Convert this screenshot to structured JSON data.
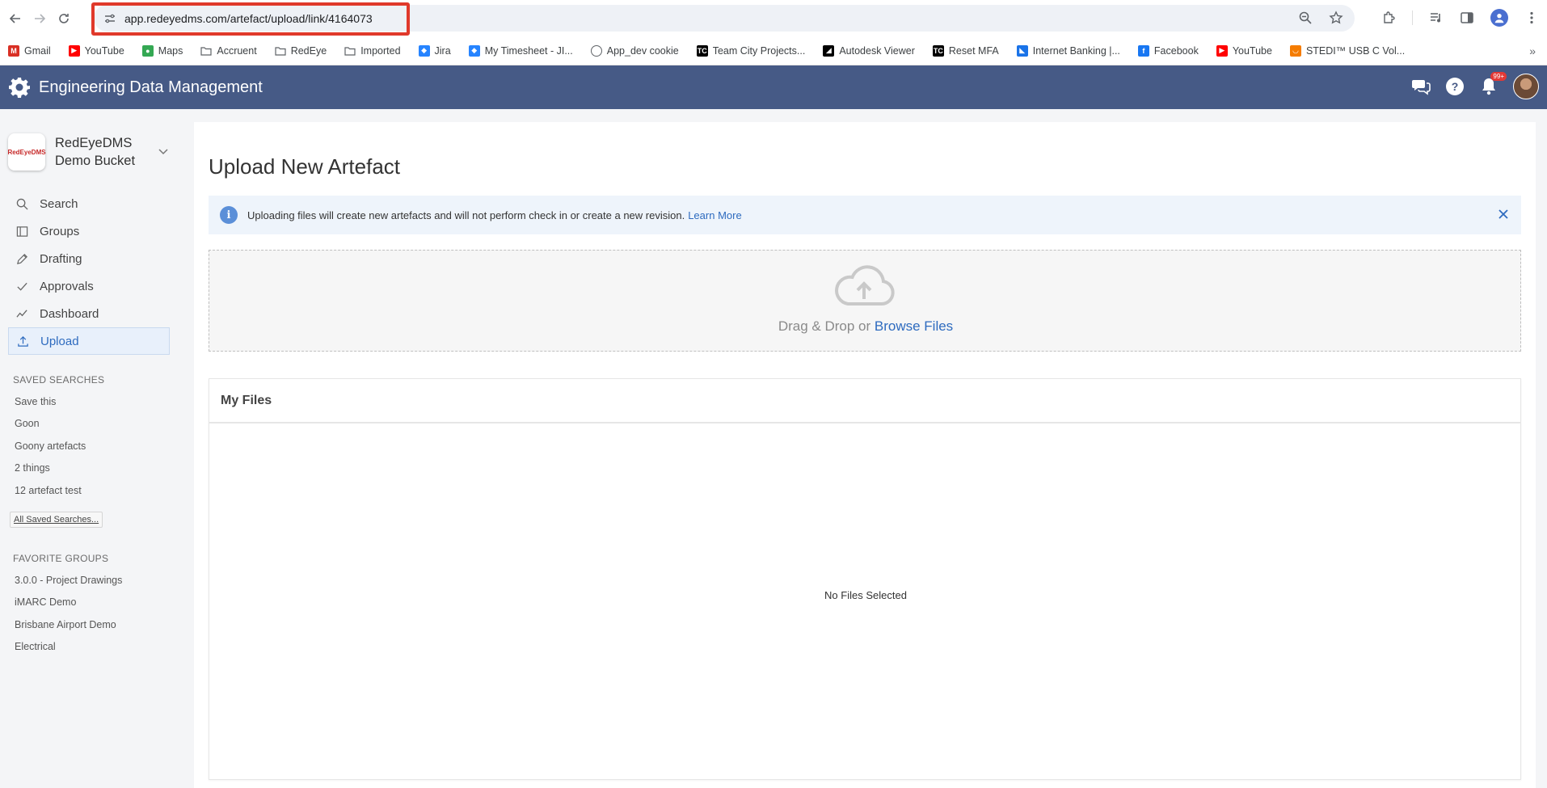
{
  "browser": {
    "url": "app.redeyedms.com/artefact/upload/link/4164073",
    "bookmarks": [
      {
        "label": "Gmail",
        "icon": "gmail-icon",
        "color": "#d93025"
      },
      {
        "label": "YouTube",
        "icon": "youtube-icon",
        "color": "#ff0000"
      },
      {
        "label": "Maps",
        "icon": "maps-icon",
        "color": "#34a853"
      },
      {
        "label": "Accruent",
        "icon": "folder-icon",
        "color": "#5f6368"
      },
      {
        "label": "RedEye",
        "icon": "folder-icon",
        "color": "#5f6368"
      },
      {
        "label": "Imported",
        "icon": "folder-icon",
        "color": "#5f6368"
      },
      {
        "label": "Jira",
        "icon": "jira-icon",
        "color": "#2684ff"
      },
      {
        "label": "My Timesheet - JI...",
        "icon": "jira-icon",
        "color": "#2684ff"
      },
      {
        "label": "App_dev cookie",
        "icon": "globe-icon",
        "color": "#5f6368"
      },
      {
        "label": "Team City Projects...",
        "icon": "teamcity-icon",
        "color": "#000000"
      },
      {
        "label": "Autodesk Viewer",
        "icon": "autodesk-icon",
        "color": "#000000"
      },
      {
        "label": "Reset MFA",
        "icon": "teamcity-icon",
        "color": "#000000"
      },
      {
        "label": "Internet Banking |...",
        "icon": "bank-icon",
        "color": "#1a73e8"
      },
      {
        "label": "Facebook",
        "icon": "facebook-icon",
        "color": "#1877f2"
      },
      {
        "label": "YouTube",
        "icon": "youtube-icon",
        "color": "#ff0000"
      },
      {
        "label": "STEDI™ USB C Vol...",
        "icon": "stedi-icon",
        "color": "#f57c00"
      }
    ]
  },
  "app": {
    "title": "Engineering Data Management",
    "notification_badge": "99+"
  },
  "workspace": {
    "logo_text": "RedEyeDMS",
    "name": "RedEyeDMS Demo Bucket"
  },
  "menu": [
    {
      "label": "Search",
      "icon": "search-icon"
    },
    {
      "label": "Groups",
      "icon": "groups-icon"
    },
    {
      "label": "Drafting",
      "icon": "pencil-icon"
    },
    {
      "label": "Approvals",
      "icon": "check-icon"
    },
    {
      "label": "Dashboard",
      "icon": "chart-line-icon"
    },
    {
      "label": "Upload",
      "icon": "upload-icon"
    }
  ],
  "saved_searches": {
    "title": "SAVED SEARCHES",
    "items": [
      "Save this",
      "Goon",
      "Goony artefacts",
      "2 things",
      "12 artefact test"
    ],
    "all_label": "All Saved Searches..."
  },
  "favorite_groups": {
    "title": "FAVORITE GROUPS",
    "items": [
      "3.0.0 - Project Drawings",
      "iMARC Demo",
      "Brisbane Airport Demo",
      "Electrical"
    ]
  },
  "main": {
    "title": "Upload New Artefact",
    "info_text": "Uploading files will create new artefacts and will not perform check in or create a new revision.",
    "info_link": "Learn More",
    "drop_text": "Drag & Drop or",
    "browse_label": "Browse Files",
    "files_title": "My Files",
    "no_files": "No Files Selected"
  },
  "colors": {
    "header": "#465a86",
    "accent": "#2e6bbf",
    "highlight": "#e0392b"
  }
}
